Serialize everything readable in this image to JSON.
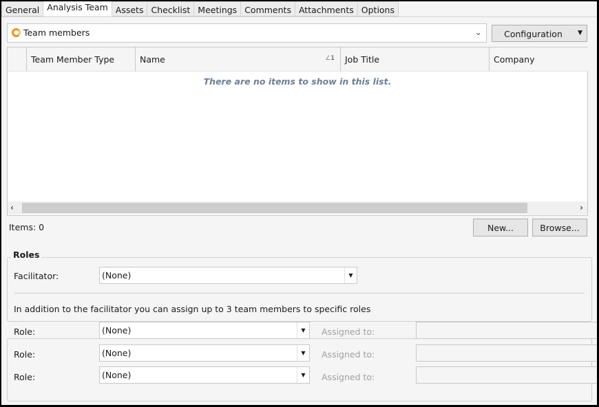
{
  "tabs": [
    "General",
    "Analysis Team",
    "Assets",
    "Checklist",
    "Meetings",
    "Comments",
    "Attachments",
    "Options"
  ],
  "active_tab": "Analysis Team",
  "view_selector": {
    "value": "Team members"
  },
  "configuration_label": "Configuration",
  "grid": {
    "columns": [
      "Team Member Type",
      "Name",
      "Job Title",
      "Company"
    ],
    "sort_indicator": "1",
    "empty_text": "There are no items to show in this list."
  },
  "items_count": "Items: 0",
  "new_label": "New...",
  "browse_label": "Browse...",
  "roles": {
    "title": "Roles",
    "facilitator_label": "Facilitator:",
    "facilitator_value": "(None)",
    "hint": "In addition to the facilitator you can assign up to 3 team members to specific roles",
    "rows": [
      {
        "label": "Role:",
        "value": "(None)",
        "assigned_label": "Assigned to:",
        "assigned_value": ""
      },
      {
        "label": "Role:",
        "value": "(None)",
        "assigned_label": "Assigned to:",
        "assigned_value": ""
      },
      {
        "label": "Role:",
        "value": "(None)",
        "assigned_label": "Assigned to:",
        "assigned_value": ""
      }
    ]
  }
}
